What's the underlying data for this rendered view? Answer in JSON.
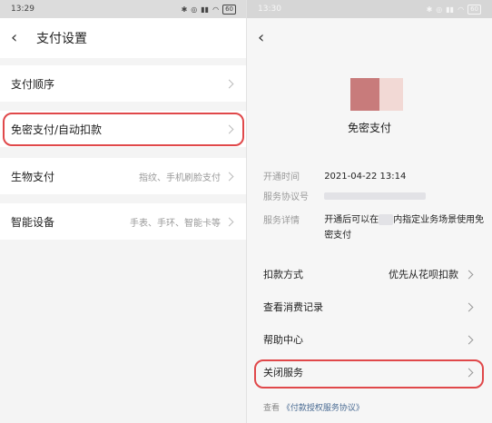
{
  "left": {
    "status": {
      "time": "13:29",
      "battery": "60"
    },
    "title": "支付设置",
    "items": [
      {
        "label": "支付顺序",
        "value": ""
      },
      {
        "label": "免密支付/自动扣款",
        "value": ""
      },
      {
        "label": "生物支付",
        "value": "指纹、手机刷脸支付"
      },
      {
        "label": "智能设备",
        "value": "手表、手环、智能卡等"
      }
    ]
  },
  "right": {
    "status": {
      "time": "13:30",
      "battery": "60"
    },
    "service_name": "免密支付",
    "info": {
      "open_time_label": "开通时间",
      "open_time_value": "2021-04-22 13:14",
      "agreement_label": "服务协议号",
      "detail_label": "服务详情",
      "detail_part1": "开通后可以在",
      "detail_part2": "内指定业务场景使用免密支付"
    },
    "rows": [
      {
        "label": "扣款方式",
        "value": "优先从花呗扣款"
      },
      {
        "label": "查看消费记录",
        "value": ""
      },
      {
        "label": "帮助中心",
        "value": ""
      },
      {
        "label": "关闭服务",
        "value": ""
      }
    ],
    "footer_prefix": "查看",
    "footer_link": "《付款授权服务协议》"
  },
  "colors": {
    "highlight": "#e0484a",
    "link": "#4a6b93"
  }
}
